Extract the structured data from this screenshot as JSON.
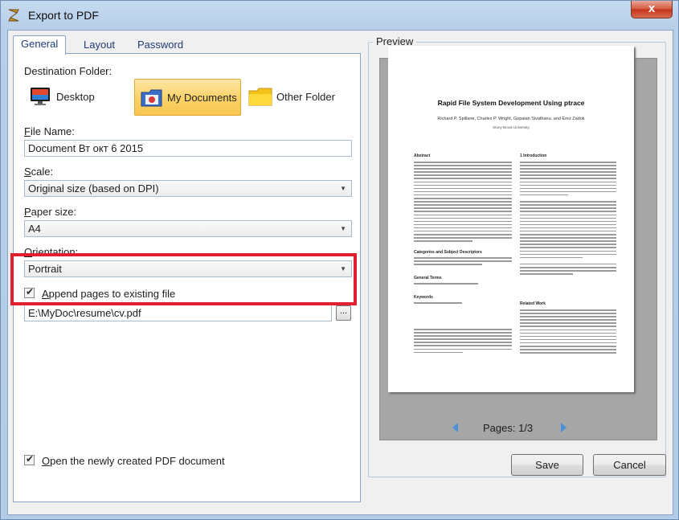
{
  "window": {
    "title": "Export to PDF",
    "close_glyph": "x"
  },
  "tabs": [
    {
      "label": "General",
      "active": true
    },
    {
      "label": "Layout",
      "active": false
    },
    {
      "label": "Password",
      "active": false
    }
  ],
  "general": {
    "destination_label": "Destination Folder:",
    "destinations": [
      {
        "label": "Desktop",
        "icon": "monitor-icon",
        "selected": false
      },
      {
        "label": "My Documents",
        "icon": "documents-folder-icon",
        "selected": true
      },
      {
        "label": "Other Folder",
        "icon": "yellow-folder-icon",
        "selected": false
      }
    ],
    "file_name_label_prefix": "F",
    "file_name_label_rest": "ile Name:",
    "file_name_value": "Document Вт окт 6 2015",
    "scale_label_prefix": "S",
    "scale_label_rest": "cale:",
    "scale_value": "Original size (based on DPI)",
    "paper_label_prefix": "P",
    "paper_label_rest": "aper size:",
    "paper_value": "A4",
    "orientation_label_prefix": "O",
    "orientation_label_rest": "rientation:",
    "orientation_value": "Portrait",
    "append_checked": true,
    "append_label_prefix": "A",
    "append_label_rest": "ppend pages to existing file",
    "append_path": "E:\\MyDoc\\resume\\cv.pdf",
    "browse_label": "...",
    "open_checked": true,
    "open_label_prefix": "O",
    "open_label_rest": "pen the newly created PDF document"
  },
  "preview": {
    "legend": "Preview",
    "page_title": "Rapid File System Development Using ptrace",
    "page_authors": "Richard P. Spillane, Charles P. Wright, Gopalan Sivathanu, and Erez Zadok",
    "page_affil": "Stony Brook University",
    "section_abstract": "Abstract",
    "section_intro": "1   Introduction",
    "section_categories": "Categories and Subject Descriptors",
    "section_terms": "General Terms",
    "section_keywords": "Keywords",
    "section_related": "Related Work",
    "pages_text": "Pages: 1/3"
  },
  "buttons": {
    "save": "Save",
    "cancel": "Cancel"
  },
  "colors": {
    "highlight": "#e0202e",
    "selected_bg": "#fbd36c",
    "pager_arrow": "#4a90d9"
  }
}
